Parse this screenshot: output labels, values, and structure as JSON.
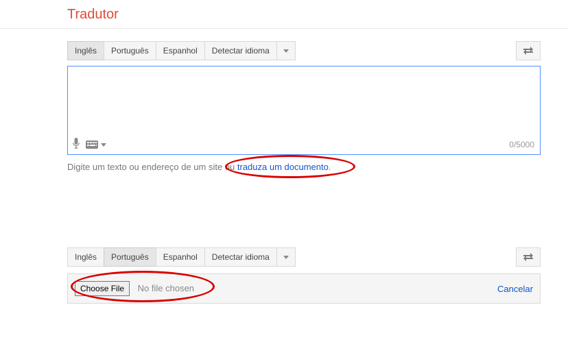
{
  "header": {
    "title": "Tradutor"
  },
  "top": {
    "langs": [
      {
        "label": "Inglês",
        "selected": true
      },
      {
        "label": "Português",
        "selected": false
      },
      {
        "label": "Espanhol",
        "selected": false
      },
      {
        "label": "Detectar idioma",
        "selected": false
      }
    ],
    "counter": "0/5000",
    "hint_prefix": "Digite um texto ou endereço de um site ou ",
    "hint_link": "traduza um documento",
    "hint_suffix": "."
  },
  "bottom": {
    "langs": [
      {
        "label": "Inglês",
        "selected": false
      },
      {
        "label": "Português",
        "selected": true
      },
      {
        "label": "Espanhol",
        "selected": false
      },
      {
        "label": "Detectar idioma",
        "selected": false
      }
    ],
    "choose_label": "Choose File",
    "nofile": "No file chosen",
    "cancel": "Cancelar"
  }
}
